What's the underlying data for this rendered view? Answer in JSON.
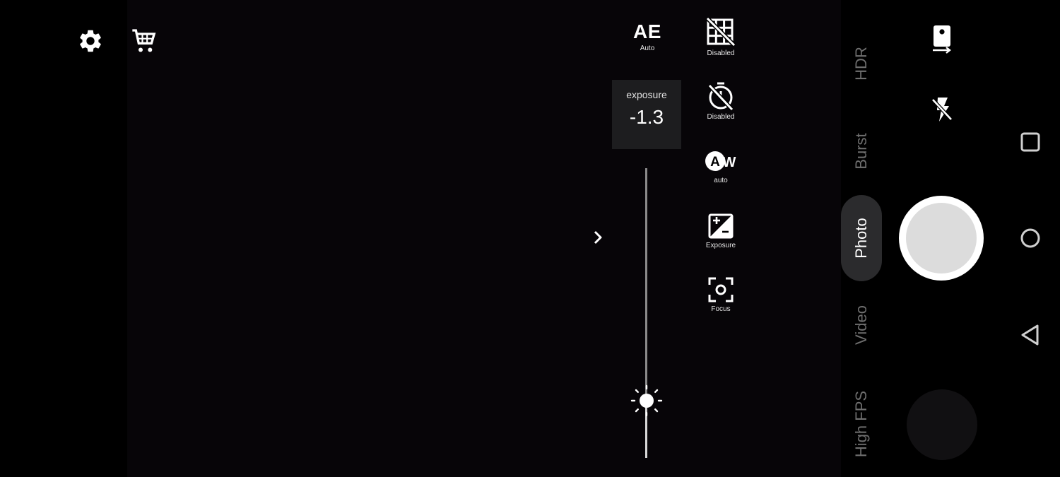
{
  "top_left": {
    "settings_icon": "gear-icon",
    "cart_icon": "cart-icon"
  },
  "ae": {
    "label": "AE",
    "value": "Auto"
  },
  "exposure_readout": {
    "title": "exposure",
    "value": "-1.3"
  },
  "exposure_slider": {
    "level_fraction": 0.19,
    "thumb_icon": "brightness-sun-icon"
  },
  "expand_icon": "chevron-right-icon",
  "controls": [
    {
      "name": "grid",
      "icon": "grid-off-icon",
      "label": "Disabled"
    },
    {
      "name": "timer",
      "icon": "timer-off-icon",
      "label": "Disabled"
    },
    {
      "name": "white-balance",
      "icon": "awb-icon",
      "label": "auto"
    },
    {
      "name": "exposure",
      "icon": "exposure-icon",
      "label": "Exposure"
    },
    {
      "name": "focus",
      "icon": "focus-icon",
      "label": "Focus"
    }
  ],
  "modes": [
    "HDR",
    "Burst",
    "Photo",
    "Video",
    "High FPS"
  ],
  "active_mode": "Photo",
  "camera": {
    "switch_icon": "switch-camera-icon",
    "flash_icon": "flash-off-icon",
    "shutter_icon": "shutter-button"
  },
  "nav": {
    "recent": "square-icon",
    "home": "circle-icon",
    "back": "triangle-back-icon"
  },
  "colors": {
    "background": "#000000",
    "inactive_mode": "#6f6f6f",
    "pill": "#2b2b2d"
  }
}
